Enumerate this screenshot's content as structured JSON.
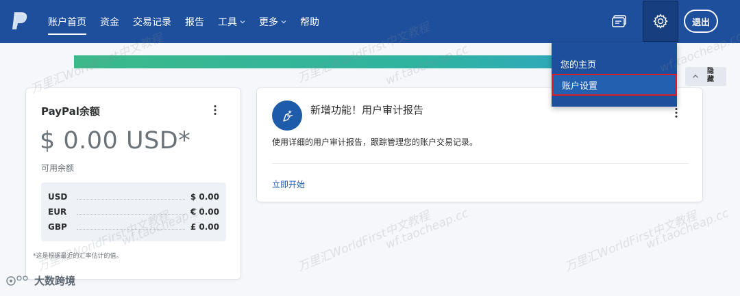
{
  "nav": {
    "items": [
      {
        "label": "账户首页",
        "active": true
      },
      {
        "label": "资金"
      },
      {
        "label": "交易记录"
      },
      {
        "label": "报告"
      },
      {
        "label": "工具",
        "dropdown": true
      },
      {
        "label": "更多",
        "dropdown": true
      },
      {
        "label": "帮助"
      }
    ],
    "logout_label": "退出",
    "message_icon": "message-icon",
    "settings_icon": "gear-icon"
  },
  "settings_menu": {
    "items": [
      {
        "label": "您的主页"
      },
      {
        "label": "账户设置",
        "highlighted": true
      }
    ]
  },
  "hide_tab": {
    "label": "隐藏"
  },
  "balance_card": {
    "title": "PayPal余额",
    "amount": "$ 0.00 USD*",
    "subtitle": "可用余额",
    "currencies": [
      {
        "code": "USD",
        "amount": "$ 0.00"
      },
      {
        "code": "EUR",
        "amount": "€ 0.00"
      },
      {
        "code": "GBP",
        "amount": "£ 0.00"
      }
    ],
    "footnote": "*这是根据最近的汇率估计的值。"
  },
  "feature_card": {
    "title": "新增功能！用户审计报告",
    "description": "使用详细的用户审计报告，跟踪管理您的账户交易记录。",
    "link": "立即开始"
  },
  "watermarks": [
    "万里汇WorldFirst中文教程",
    "wf.taocheap.cc"
  ],
  "badge": {
    "label": "大数跨境"
  },
  "colors": {
    "nav_bg": "#1e4f9c",
    "link": "#1e5ba8",
    "highlight_border": "#d81f26",
    "progress_start": "#3cb98a",
    "progress_end": "#2e9fd0"
  }
}
